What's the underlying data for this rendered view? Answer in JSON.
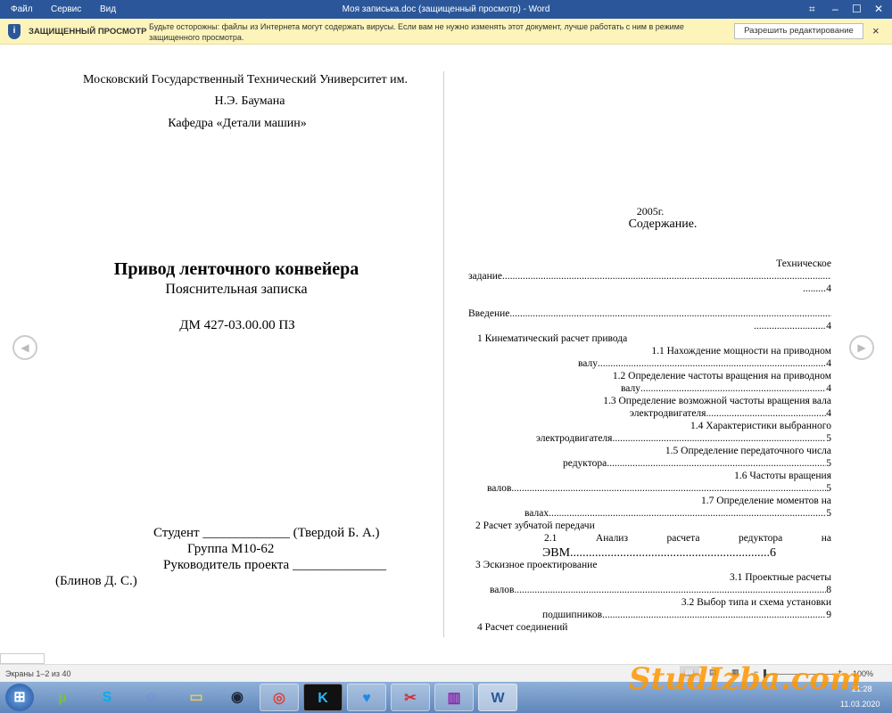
{
  "titlebar": {
    "menu": [
      "Файл",
      "Сервис",
      "Вид"
    ],
    "title": "Моя записька.doc (защищенный просмотр) - Word"
  },
  "protected": {
    "label": "ЗАЩИЩЕННЫЙ ПРОСМОТР",
    "message1": "Будьте осторожны: файлы из Интернета могут содержать вирусы. Если вам не нужно изменять этот документ, лучше работать с ним в режиме",
    "message2": "защищенного просмотра.",
    "button": "Разрешить редактирование",
    "close": "×"
  },
  "page1": {
    "l1": "Московский Государственный Технический Университет им.",
    "l2": "Н.Э. Баумана",
    "l3": "Кафедра «Детали машин»",
    "title": "Привод ленточного конвейера",
    "subtitle": "Пояснительная записка",
    "code": "ДМ 427-03.00.00 ПЗ",
    "student": "Студент _____________ (Твердой Б. А.)",
    "group": "Группа М10-62",
    "lead": "Руководитель проекта  ______________",
    "lead_name": "(Блинов Д. С.)"
  },
  "page2": {
    "year": "2005г.",
    "heading": "Содержание.",
    "toc": [
      "Техническое",
      "задание",
      "4",
      "Введение",
      "4",
      "1 Кинематический расчет привода",
      "1.1 Нахождение мощности на приводном",
      "валу",
      "4",
      "1.2 Определение частоты вращения на приводном",
      "валу",
      "4",
      "1.3 Определение возможной частоты вращения вала",
      "электродвигателя",
      "4",
      "1.4 Характеристики выбранного",
      "электродвигателя",
      "5",
      "1.5 Определение передаточного числа",
      "редуктора",
      "5",
      "1.6 Частоты вращения",
      "валов",
      "5",
      "1.7 Определение моментов на",
      "валах",
      "5",
      "2 Расчет зубчатой передачи",
      "2.1",
      "Анализ",
      "расчета",
      "редуктора",
      "на",
      "ЭВМ",
      "6",
      "3 Эскизное проектирование",
      "3.1 Проектные расчеты",
      "валов",
      "8",
      "3.2 Выбор типа и схема установки",
      "подшипников",
      "9",
      "4  Расчет соединений"
    ]
  },
  "status": {
    "screens": "Экраны 1–2 из 40",
    "zoom": "100%"
  },
  "taskbar": {
    "time": "21:28",
    "date": "11.03.2020"
  },
  "watermark": "StudIzba.com"
}
